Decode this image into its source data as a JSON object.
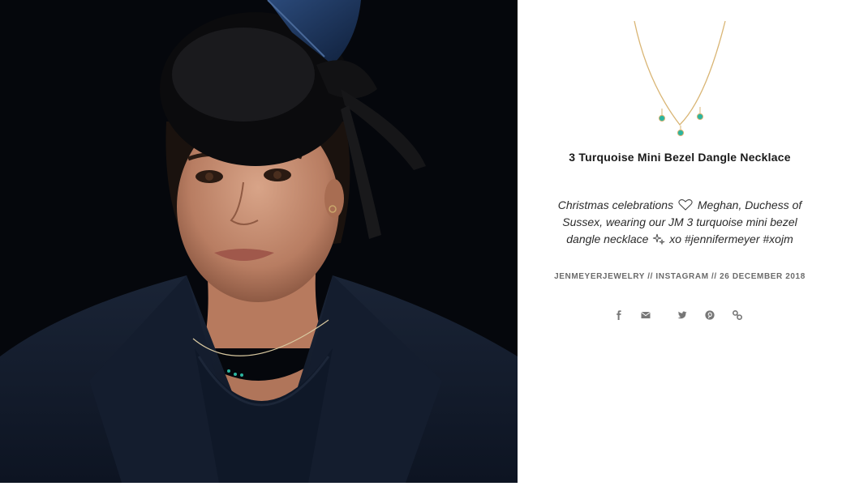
{
  "product": {
    "title": "3 Turquoise Mini Bezel Dangle Necklace",
    "thumbnail_icon": "necklace-image"
  },
  "post": {
    "caption_start": "Christmas celebrations",
    "caption_heart_icon": "heart-icon",
    "caption_middle": "Meghan, Duchess of Sussex, wearing our JM 3 turquoise mini bezel dangle necklace",
    "caption_sparkle_icon": "sparkles-icon",
    "caption_end": "xo #jennifermeyer #xojm",
    "meta": "JENMEYERJEWELRY // INSTAGRAM // 26 DECEMBER 2018"
  },
  "share": {
    "items": [
      {
        "name": "facebook",
        "icon": "facebook-icon"
      },
      {
        "name": "email",
        "icon": "envelope-icon"
      },
      {
        "name": "twitter",
        "icon": "twitter-icon"
      },
      {
        "name": "pinterest",
        "icon": "pinterest-icon"
      },
      {
        "name": "link",
        "icon": "link-icon"
      }
    ]
  },
  "colors": {
    "background": "#ffffff",
    "photo_background": "#05070c",
    "title": "#1a1a1a",
    "meta": "#6b6b6b",
    "chain_gold": "#d9b574",
    "turquoise": "#2bb5a0",
    "icon": "#777777"
  }
}
